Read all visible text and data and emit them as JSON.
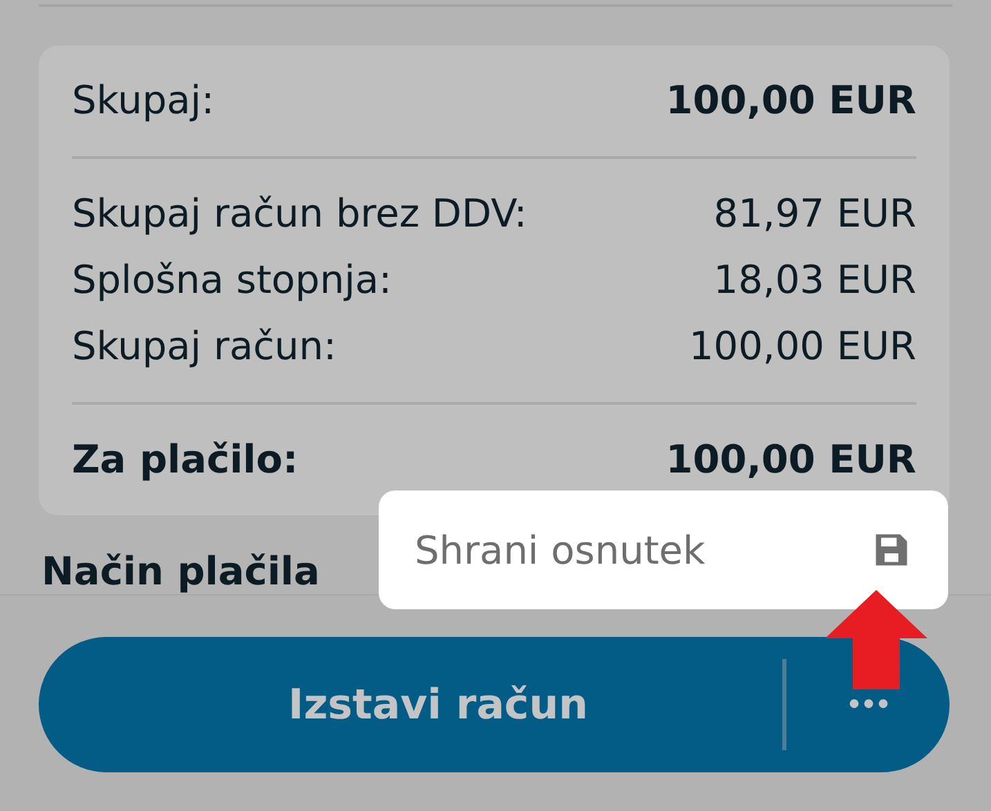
{
  "summary": {
    "rows": [
      {
        "kind": "total",
        "label": "Skupaj:",
        "value": "100,00 EUR"
      },
      {
        "kind": "line",
        "label": "Skupaj račun brez DDV:",
        "value": "81,97 EUR"
      },
      {
        "kind": "line",
        "label": "Splošna stopnja:",
        "value": "18,03 EUR"
      },
      {
        "kind": "line",
        "label": "Skupaj račun:",
        "value": "100,00 EUR"
      },
      {
        "kind": "grand",
        "label": "Za plačilo:",
        "value": "100,00 EUR"
      }
    ]
  },
  "section_heading": "Način plačila",
  "popup_menu": {
    "items": [
      {
        "label": "Shrani osnutek",
        "kind": "save"
      }
    ]
  },
  "action_bar": {
    "primary_button": "Izstavi račun",
    "more_button": "•••"
  },
  "annotation": {
    "kind": "arrow"
  }
}
